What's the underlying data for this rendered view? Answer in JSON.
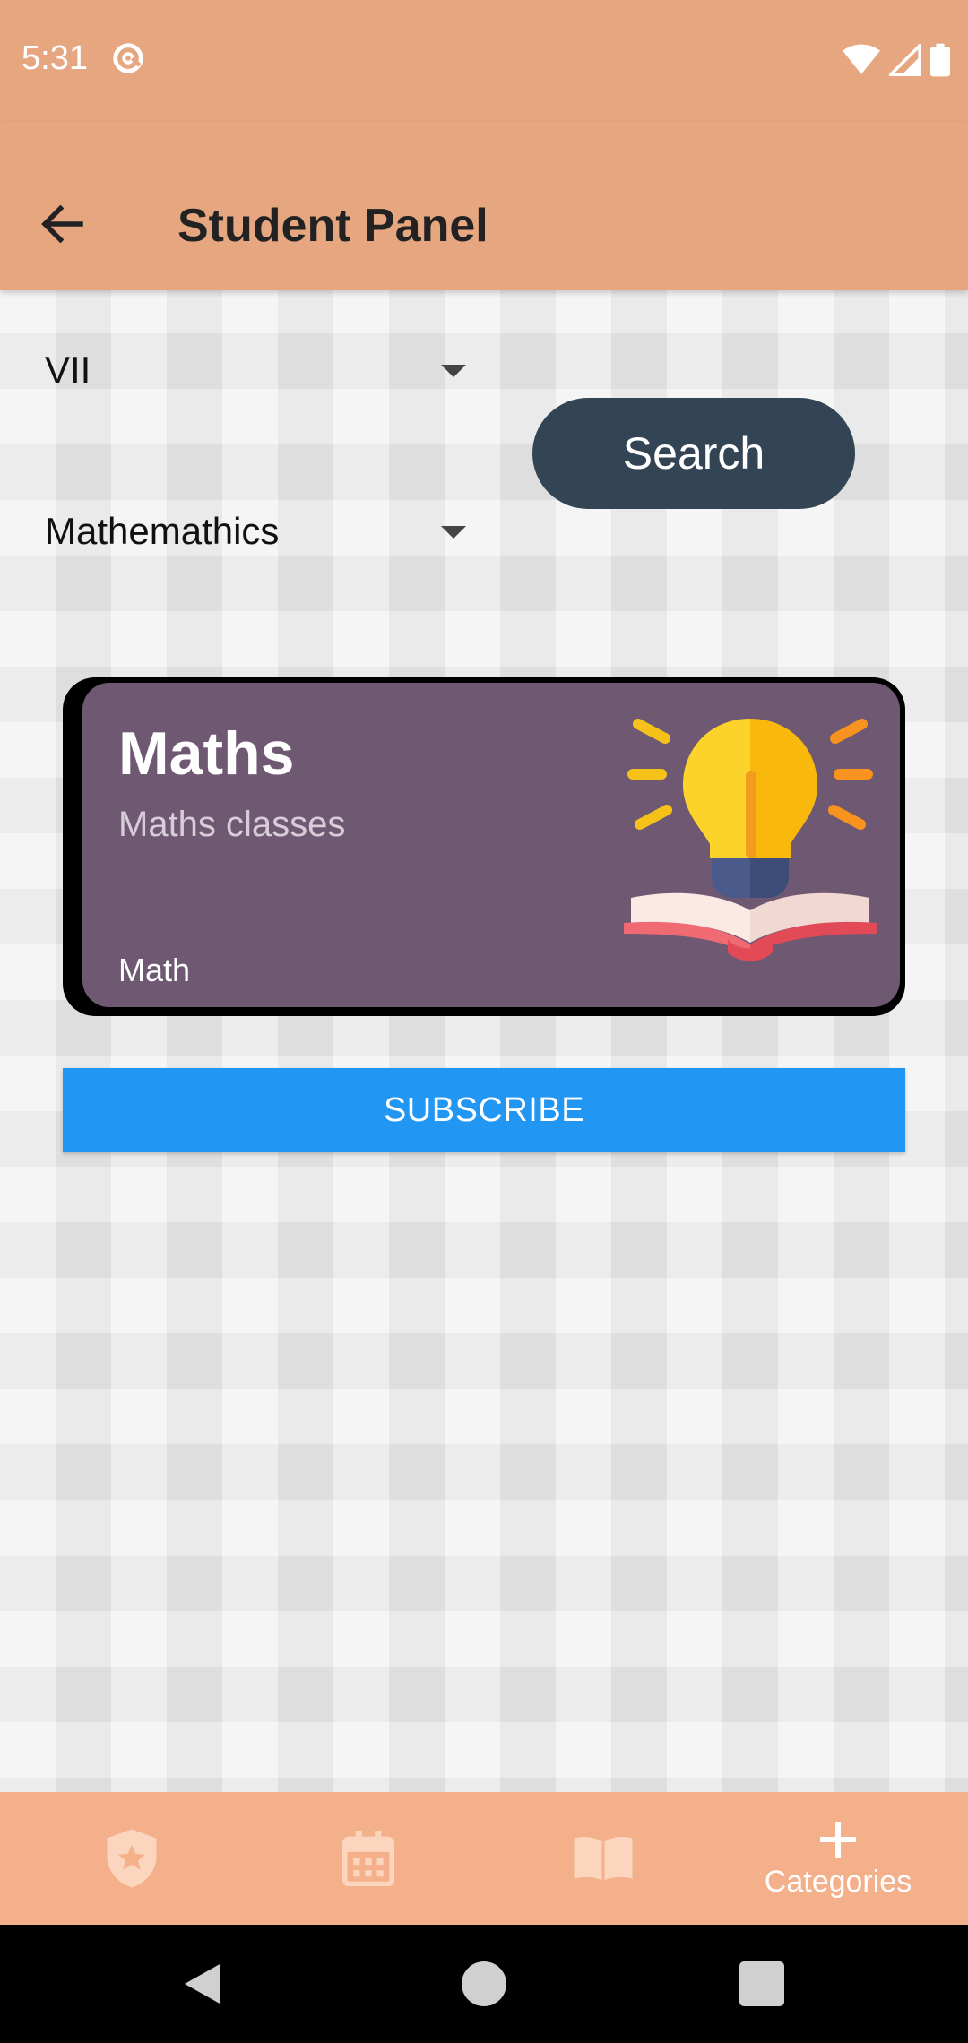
{
  "status_bar": {
    "time": "5:31",
    "icons": [
      "at-circle-icon",
      "wifi-icon",
      "signal-icon",
      "battery-icon"
    ]
  },
  "app_bar": {
    "title": "Student Panel",
    "back_icon": "arrow-back-icon"
  },
  "filters": {
    "class_value": "VII",
    "subject_value": "Mathemathics",
    "search_label": "Search"
  },
  "card": {
    "title": "Maths",
    "subtitle": "Maths classes",
    "tag": "Math",
    "image_icon": "lightbulb-book-icon"
  },
  "subscribe_label": "SUBSCRIBE",
  "bottom_nav": {
    "items": [
      {
        "icon": "shield-star-icon",
        "label": ""
      },
      {
        "icon": "calendar-icon",
        "label": ""
      },
      {
        "icon": "book-icon",
        "label": ""
      },
      {
        "icon": "plus-icon",
        "label": "Categories"
      }
    ]
  },
  "system_nav": [
    "back-triangle-icon",
    "home-circle-icon",
    "recents-square-icon"
  ],
  "colors": {
    "app_bar": "#e6a680",
    "bottom_nav": "#f4b08a",
    "search_button": "#334455",
    "card_bg": "#6f5872",
    "subscribe": "#2196f3"
  }
}
